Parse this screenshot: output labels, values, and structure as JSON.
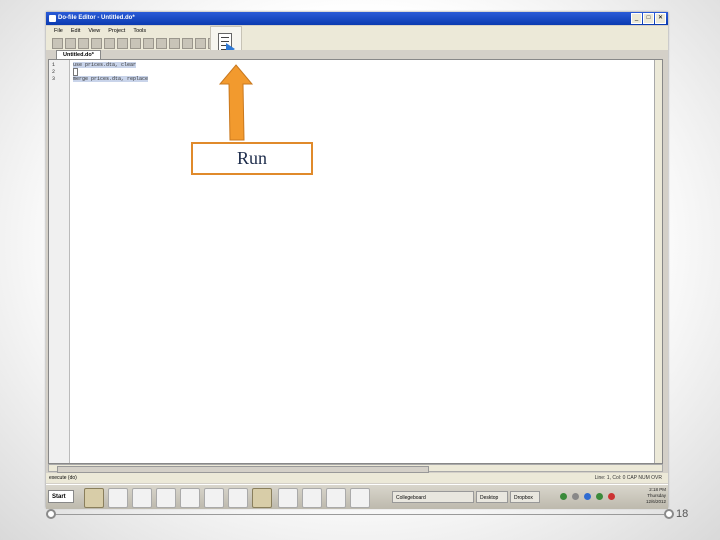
{
  "window": {
    "title": "Do-file Editor - Untitled.do*",
    "controls": [
      "_",
      "□",
      "✕"
    ]
  },
  "menu": [
    "File",
    "Edit",
    "View",
    "Project",
    "Tools"
  ],
  "toolbar": {
    "icons": [
      "new-icon",
      "open-icon",
      "save-icon",
      "print-icon",
      "find-icon",
      "cut-icon",
      "copy-icon",
      "paste-icon",
      "undo-icon",
      "redo-icon",
      "indent-icon",
      "outdent-icon",
      "comment-icon",
      "bookmark-icon"
    ],
    "run_button_icon": "execute-do-icon"
  },
  "tab": {
    "label": "Untitled.do*"
  },
  "editor": {
    "lines": [
      {
        "num": "1",
        "code": "use prices.dta, clear"
      },
      {
        "num": "2",
        "code": ""
      },
      {
        "num": "3",
        "code": "merge prices.dta, replace"
      }
    ]
  },
  "status": {
    "left": "execute (do)",
    "right": "Line: 1, Col: 0    CAP   NUM   OVR"
  },
  "taskbar": {
    "start": "Start",
    "buttons": [
      "Collegeboard",
      "Desktop",
      "Dropbox"
    ],
    "clock": [
      "2:18 PM",
      "Thursday",
      "12/6/2012"
    ]
  },
  "annotation": {
    "label": "Run",
    "color": "#e08a2b",
    "arrow_color": "#f29a2e"
  },
  "slide": {
    "page_number": "18"
  }
}
